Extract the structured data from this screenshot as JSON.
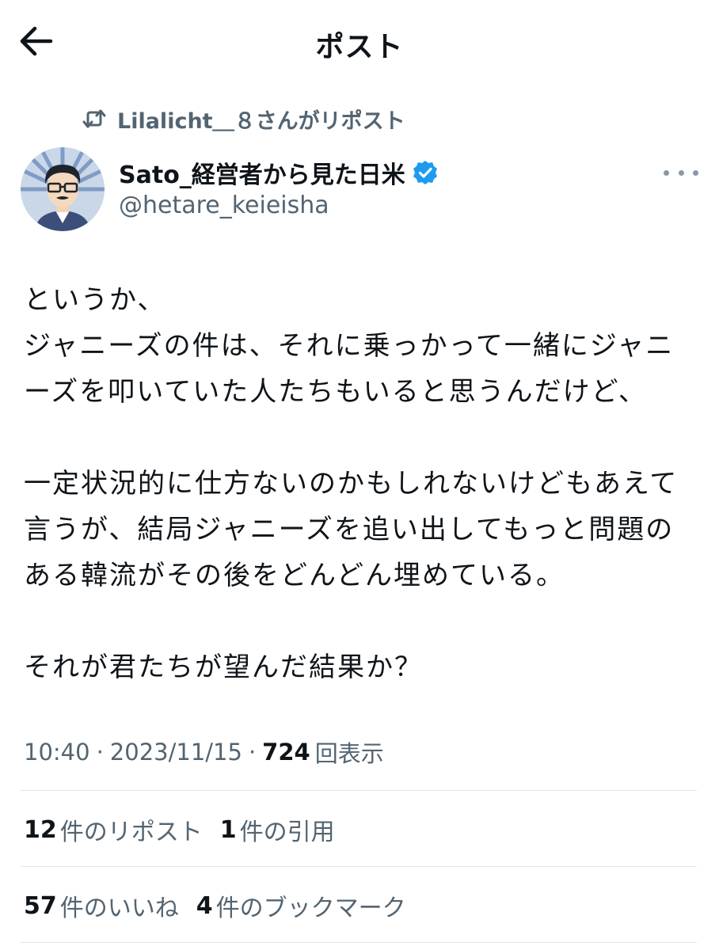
{
  "header": {
    "title": "ポスト",
    "back_icon": "arrow-left-icon"
  },
  "repost": {
    "icon": "repost-icon",
    "text": "Lilalicht＿８さんがリポスト"
  },
  "author": {
    "display_name": "Sato_経営者から見た日米",
    "handle": "@hetare_keieisha",
    "verified_icon": "verified-badge-icon",
    "verified_color": "#1d9bf0"
  },
  "tweet": {
    "lines": [
      "というか、",
      "ジャニーズの件は、それに乗っかって一緒にジャニ",
      "ーズを叩いていた人たちもいると思うんだけど、",
      "",
      "一定状況的に仕方ないのかもしれないけどもあえて",
      "言うが、結局ジャニーズを追い出してもっと問題の",
      "ある韓流がその後をどんどん埋めている。",
      "",
      "それが君たちが望んだ結果か？"
    ]
  },
  "meta": {
    "time": "10:40",
    "separator": "·",
    "date": "2023/11/15",
    "views_count": "724",
    "views_label": "回表示"
  },
  "stats": {
    "reposts_count": "12",
    "reposts_label": "件のリポスト",
    "quotes_count": "1",
    "quotes_label": "件の引用",
    "likes_count": "57",
    "likes_label": "件のいいね",
    "bookmarks_count": "4",
    "bookmarks_label": "件のブックマーク"
  },
  "colors": {
    "text_primary": "#0f1419",
    "text_secondary": "#536471",
    "divider": "#e1e6ea"
  }
}
